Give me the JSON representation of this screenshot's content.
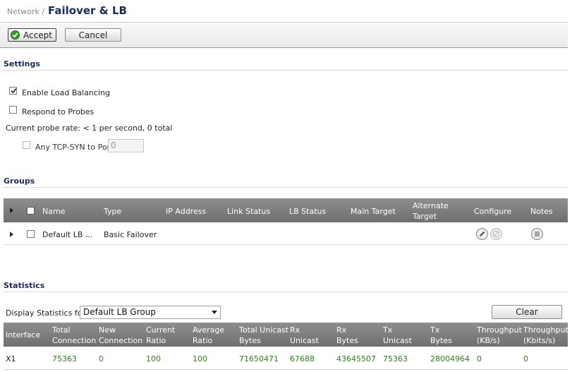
{
  "header": {
    "breadcrumb": "Network /",
    "title": "Failover & LB"
  },
  "toolbar": {
    "accept_label": "Accept",
    "cancel_label": "Cancel"
  },
  "settings": {
    "heading": "Settings",
    "enable_lb": {
      "label": "Enable Load Balancing",
      "checked": true
    },
    "respond_probes": {
      "label": "Respond to Probes",
      "checked": false
    },
    "probe_rate": "Current probe rate: < 1 per second, 0 total",
    "tcp_syn": {
      "label": "Any TCP-SYN to Port",
      "checked": false,
      "port_value": "0"
    }
  },
  "groups": {
    "heading": "Groups",
    "columns": [
      "Name",
      "Type",
      "IP Address",
      "Link Status",
      "LB Status",
      "Main Target",
      "Alternate",
      "Target",
      "Configure",
      "Notes"
    ],
    "rows": [
      {
        "name": "Default LB ...",
        "type": "Basic Failover",
        "ip": "",
        "link_status": "",
        "lb_status": "",
        "main_target": "",
        "alt_target": ""
      }
    ]
  },
  "statistics": {
    "heading": "Statistics",
    "display_label": "Display Statistics for:",
    "selected_group": "Default LB Group",
    "clear_label": "Clear",
    "columns": [
      [
        "Interface",
        ""
      ],
      [
        "Total",
        "Connection"
      ],
      [
        "New",
        "Connection"
      ],
      [
        "Current",
        "Ratio"
      ],
      [
        "Average",
        "Ratio"
      ],
      [
        "Total Unicast",
        "Bytes"
      ],
      [
        "Rx",
        "Unicast"
      ],
      [
        "Rx",
        "Bytes"
      ],
      [
        "Tx",
        "Unicast"
      ],
      [
        "Tx",
        "Bytes"
      ],
      [
        "Throughput",
        "(KB/s)"
      ],
      [
        "Throughput",
        "(Kbits/s)"
      ]
    ],
    "rows": [
      [
        "X1",
        "75363",
        "0",
        "100",
        "100",
        "71650471",
        "67688",
        "43645507",
        "75363",
        "28004964",
        "0",
        "0"
      ]
    ]
  },
  "colors": {
    "heading": "#1a2a5a",
    "value_green": "#2e7d1a",
    "table_header": "#7f7f7f"
  },
  "icons": {
    "accept": "check-circle-icon",
    "configure_edit": "pencil-icon",
    "configure_delete": "no-icon",
    "notes": "notes-icon"
  }
}
